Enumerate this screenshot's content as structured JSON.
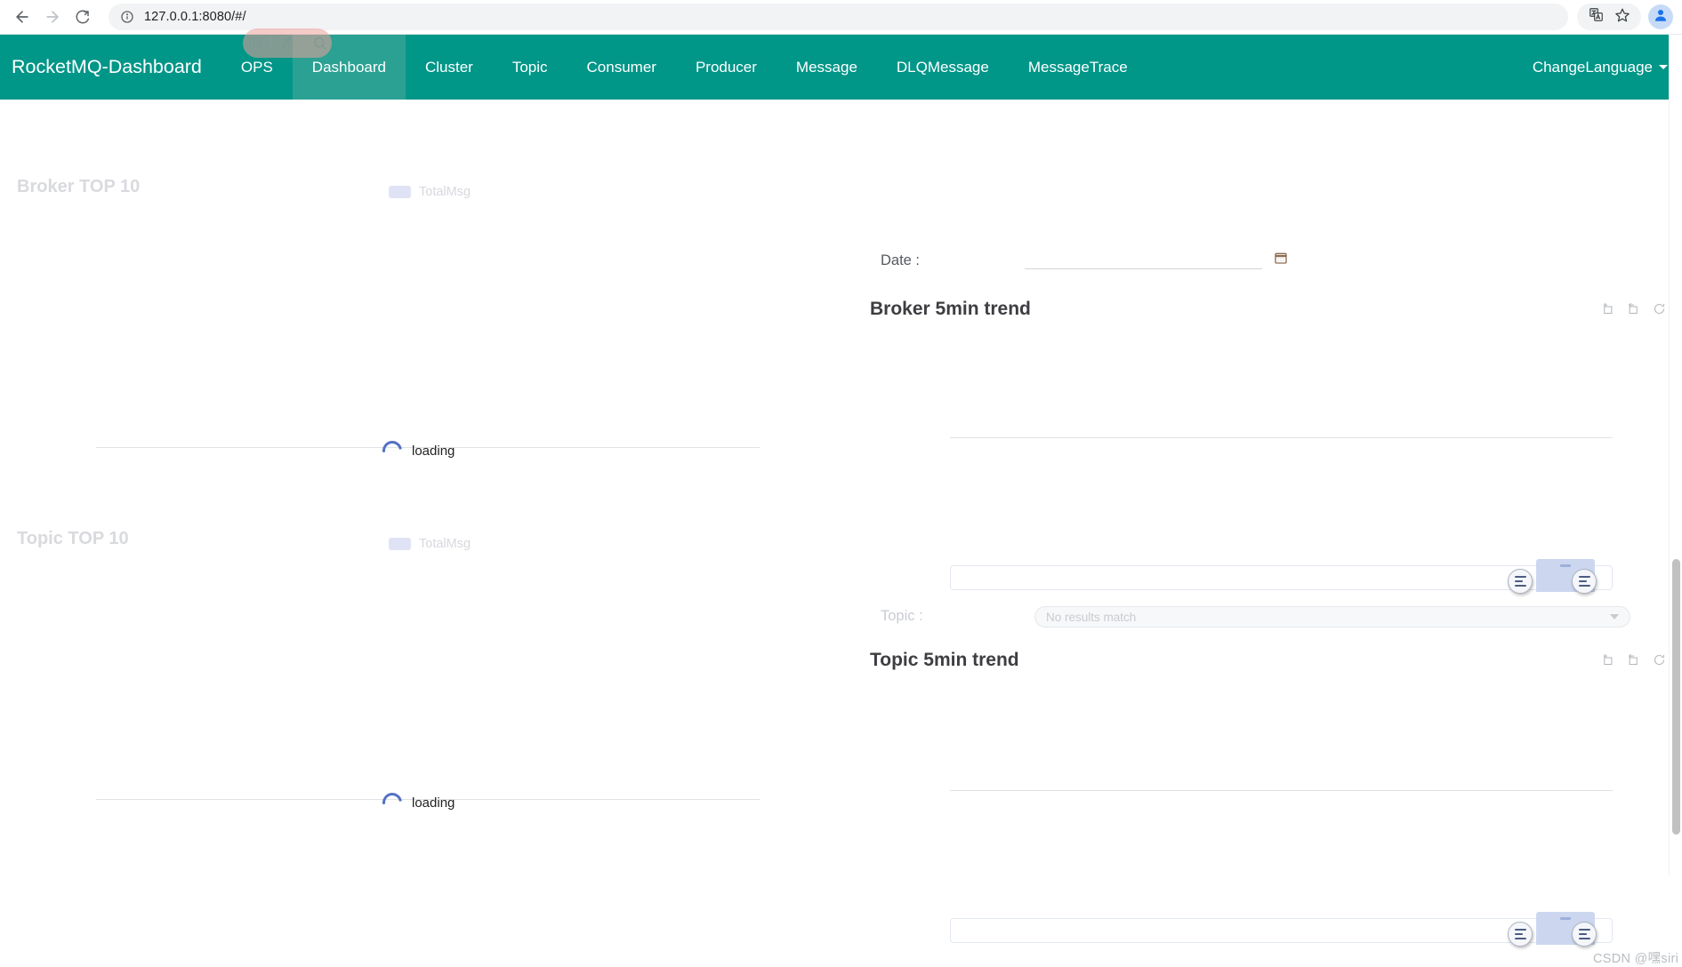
{
  "browser": {
    "url": "127.0.0.1:8080/#/",
    "back_icon": "back-arrow-icon",
    "forward_icon": "forward-arrow-icon",
    "reload_icon": "reload-icon",
    "info_icon": "site-info-icon",
    "translate_icon": "translate-icon",
    "bookmark_icon": "star-icon",
    "profile_icon": "profile-avatar-icon"
  },
  "overlay": {
    "ai_icon": "ai-badge-icon",
    "wand_icon": "magic-wand-icon",
    "search_icon": "search-icon"
  },
  "navbar": {
    "brand": "RocketMQ-Dashboard",
    "items": [
      {
        "label": "OPS",
        "active": false
      },
      {
        "label": "Dashboard",
        "active": true
      },
      {
        "label": "Cluster",
        "active": false
      },
      {
        "label": "Topic",
        "active": false
      },
      {
        "label": "Consumer",
        "active": false
      },
      {
        "label": "Producer",
        "active": false
      },
      {
        "label": "Message",
        "active": false
      },
      {
        "label": "DLQMessage",
        "active": false
      },
      {
        "label": "MessageTrace",
        "active": false
      }
    ],
    "language": "ChangeLanguage",
    "accent_color": "#009688",
    "active_color": "#2ba193"
  },
  "left_panels": [
    {
      "title": "Broker TOP 10",
      "legend_label": "TotalMsg",
      "legend_color": "#dfe3f5",
      "loading_text": "loading",
      "spinner_color": "#5470c6"
    },
    {
      "title": "Topic TOP 10",
      "legend_label": "TotalMsg",
      "legend_color": "#dfe3f5",
      "loading_text": "loading",
      "spinner_color": "#5470c6"
    }
  ],
  "right_panels": [
    {
      "field_label": "Date :",
      "field_value": "",
      "calendar_icon": "calendar-icon",
      "heading": "Broker 5min trend",
      "toolbox": [
        "data-zoom-icon",
        "restore-zoom-icon",
        "refresh-icon",
        "download-icon"
      ],
      "input_value": ""
    },
    {
      "field_label": "Topic :",
      "select_placeholder": "No results match",
      "heading": "Topic 5min trend",
      "toolbox": [
        "data-zoom-icon",
        "restore-zoom-icon",
        "refresh-icon",
        "download-icon"
      ],
      "input_value": ""
    }
  ],
  "watermark": "CSDN @嘿siri"
}
